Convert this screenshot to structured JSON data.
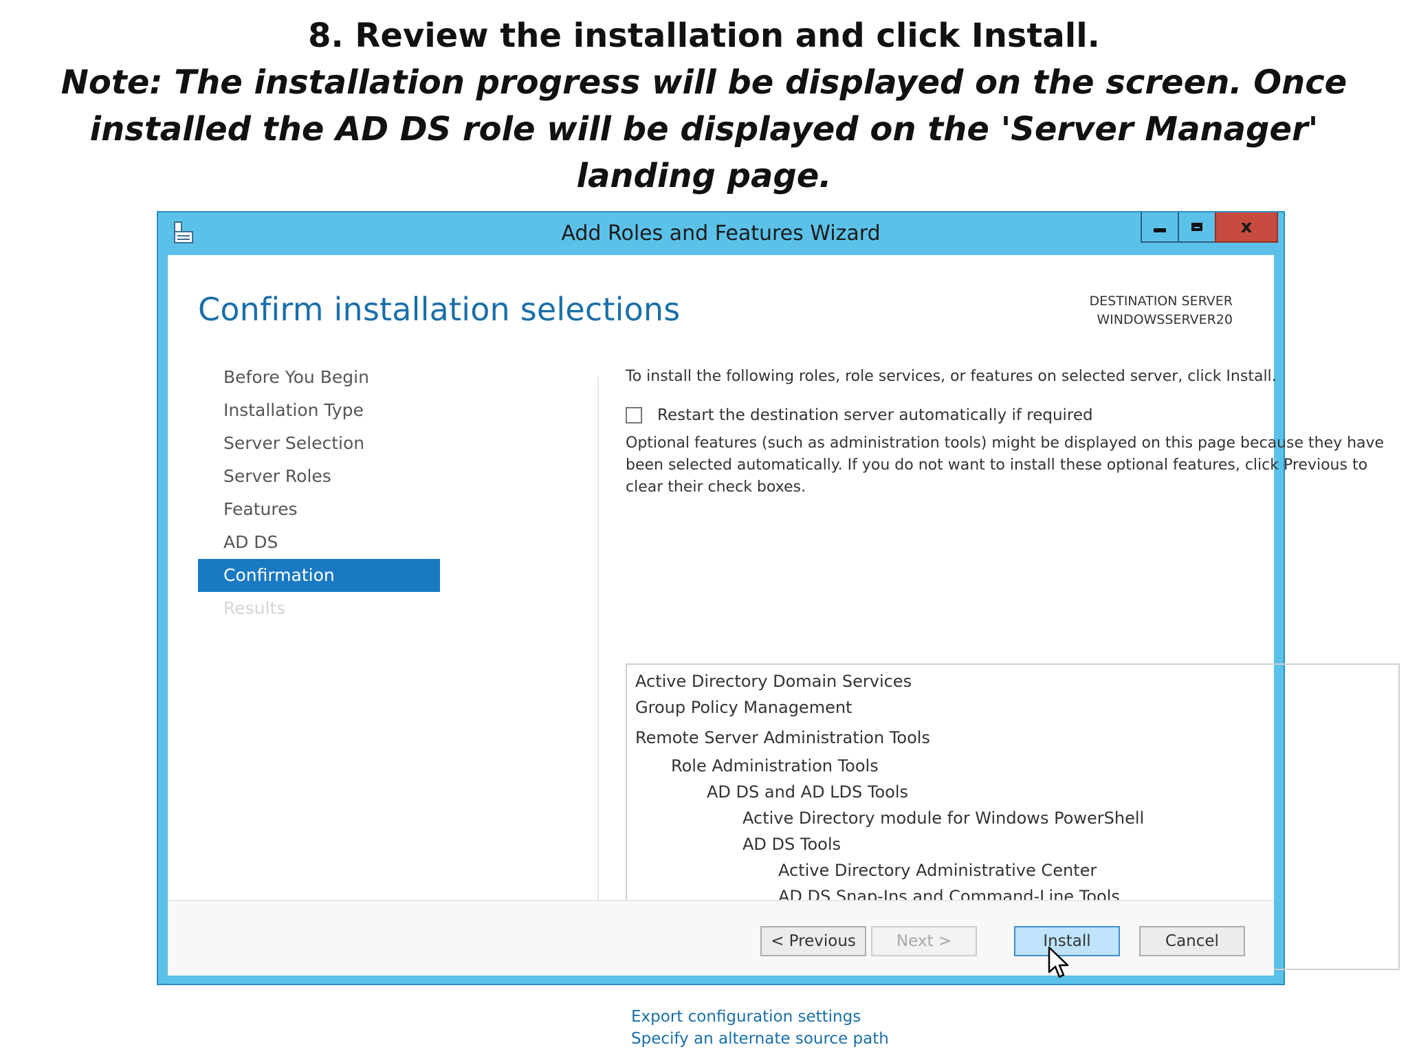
{
  "caption": {
    "line1": "8. Review the installation and click Install.",
    "note": "Note: The installation progress will be displayed on the screen. Once installed the AD DS role will be displayed on the 'Server Manager' landing page."
  },
  "window": {
    "title": "Add Roles and Features Wizard",
    "close_glyph": "x"
  },
  "page": {
    "heading": "Confirm installation selections",
    "destination_label": "DESTINATION SERVER",
    "destination_server": "WINDOWSSERVER20"
  },
  "nav": {
    "items": [
      {
        "label": "Before You Begin",
        "state": "normal"
      },
      {
        "label": "Installation Type",
        "state": "normal"
      },
      {
        "label": "Server Selection",
        "state": "normal"
      },
      {
        "label": "Server Roles",
        "state": "normal"
      },
      {
        "label": "Features",
        "state": "normal"
      },
      {
        "label": "AD DS",
        "state": "normal"
      },
      {
        "label": "Confirmation",
        "state": "active"
      },
      {
        "label": "Results",
        "state": "disabled"
      }
    ]
  },
  "main": {
    "intro": "To install the following roles, role services, or features on selected server, click Install.",
    "restart_label": "Restart the destination server automatically if required",
    "restart_checked": false,
    "optional_text": "Optional features (such as administration tools) might be displayed on this page because they have been selected automatically. If you do not want to install these optional features, click Previous to clear their check boxes.",
    "selections": [
      {
        "label": "Active Directory Domain Services",
        "level": 0
      },
      {
        "label": "Group Policy Management",
        "level": 0
      },
      {
        "label": "Remote Server Administration Tools",
        "level": 0
      },
      {
        "label": "Role Administration Tools",
        "level": 1
      },
      {
        "label": "AD DS and AD LDS Tools",
        "level": 2
      },
      {
        "label": "Active Directory module for Windows PowerShell",
        "level": 3
      },
      {
        "label": "AD DS Tools",
        "level": 3
      },
      {
        "label": "Active Directory Administrative Center",
        "level": 4
      },
      {
        "label": "AD DS Snap-Ins and Command-Line Tools",
        "level": 4
      }
    ],
    "links": {
      "export": "Export configuration settings",
      "alternate_source": "Specify an alternate source path"
    }
  },
  "footer": {
    "previous": "< Previous",
    "next": "Next >",
    "install": "Install",
    "cancel": "Cancel"
  },
  "colors": {
    "title_bar": "#5bc1e9",
    "accent": "#1979c3",
    "link": "#1a6fa8",
    "close_button": "#c74b3f"
  }
}
